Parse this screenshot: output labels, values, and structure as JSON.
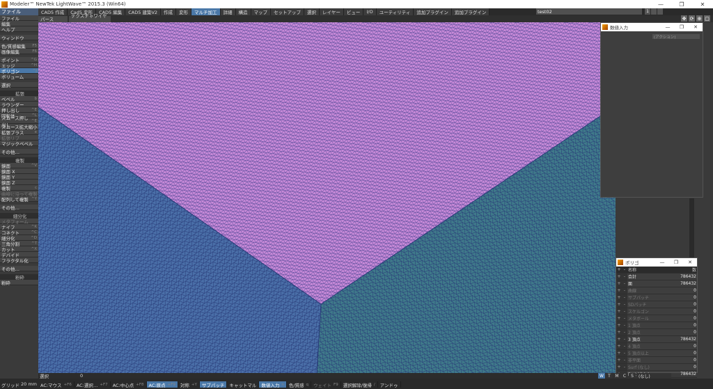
{
  "window": {
    "title": "Modeler™ NewTek LightWave™ 2015.3 (Win64)",
    "buttons": [
      "—",
      "❐",
      "✕"
    ]
  },
  "menubar": {
    "left": "ファイル",
    "tabs": [
      {
        "label": "CAD5 作成",
        "active": false
      },
      {
        "label": "Cad5 変形",
        "active": false
      },
      {
        "label": "CAD5 編集",
        "active": false
      },
      {
        "label": "CAD5 建築V2",
        "active": false
      },
      {
        "label": "作成",
        "active": false
      },
      {
        "label": "変形",
        "active": false
      },
      {
        "label": "マルチ加工",
        "active": true
      },
      {
        "label": "詳細",
        "active": false
      },
      {
        "label": "構造",
        "active": false
      },
      {
        "label": "マップ",
        "active": false
      },
      {
        "label": "セットアップ",
        "active": false
      },
      {
        "label": "選択",
        "active": false
      },
      {
        "label": "レイヤー",
        "active": false
      },
      {
        "label": "ビュー",
        "active": false
      },
      {
        "label": "I/O",
        "active": false
      },
      {
        "label": "ユーティリティ",
        "active": false
      },
      {
        "label": "追加プラグイン",
        "active": false
      },
      {
        "label": "追加プラグイン",
        "active": false
      }
    ],
    "object": "test02",
    "layers": [
      "1"
    ]
  },
  "toolbar": {
    "view_dropdown": "パース",
    "mode_dropdown": "テクスチャワイヤー"
  },
  "sidebar": [
    {
      "label": "ファイル",
      "key": "",
      "type": "item"
    },
    {
      "label": "編集",
      "key": "",
      "type": "item"
    },
    {
      "label": "ヘルプ",
      "key": "",
      "type": "item"
    },
    {
      "label": "",
      "key": "",
      "type": "gap"
    },
    {
      "label": "ウィンドウ",
      "key": "",
      "type": "item"
    },
    {
      "label": "",
      "key": "",
      "type": "gap"
    },
    {
      "label": "色/質感編集",
      "key": "F5",
      "type": "item"
    },
    {
      "label": "画像編集",
      "key": "F6",
      "type": "item"
    },
    {
      "label": "",
      "key": "",
      "type": "gap"
    },
    {
      "label": "ポイント",
      "key": "^G",
      "type": "item"
    },
    {
      "label": "エッジ",
      "key": "^H",
      "type": "item"
    },
    {
      "label": "ポリゴン",
      "key": "^J",
      "type": "sel"
    },
    {
      "label": "ボリューム",
      "key": "",
      "type": "item"
    },
    {
      "label": "",
      "key": "",
      "type": "gap"
    },
    {
      "label": "選択",
      "key": "",
      "type": "item"
    },
    {
      "label": "",
      "key": "",
      "type": "gap"
    },
    {
      "label": "拡張",
      "key": "",
      "type": "hdr"
    },
    {
      "label": "ベベル",
      "key": "b",
      "type": "item"
    },
    {
      "label": "ラウンダー",
      "key": "",
      "type": "item"
    },
    {
      "label": "押し出し",
      "key": "^E",
      "type": "item"
    },
    {
      "label": "回転体",
      "key": "^L",
      "type": "item"
    },
    {
      "label": "スムース押し出し",
      "key": "^E",
      "type": "item"
    },
    {
      "label": "スムース拡大縮小",
      "key": "",
      "type": "item"
    },
    {
      "label": "拡張プラス",
      "key": "e",
      "type": "item"
    },
    {
      "label": "拡張リブ",
      "key": "",
      "type": "dis"
    },
    {
      "label": "マジックベベル",
      "key": "",
      "type": "item"
    },
    {
      "label": "",
      "key": "",
      "type": "gap"
    },
    {
      "label": "その他…",
      "key": "",
      "type": "item"
    },
    {
      "label": "",
      "key": "",
      "type": "gap"
    },
    {
      "label": "複製",
      "key": "",
      "type": "hdr"
    },
    {
      "label": "鏡面",
      "key": "^V",
      "type": "item"
    },
    {
      "label": "鏡面 X",
      "key": "",
      "type": "item"
    },
    {
      "label": "鏡面 Y",
      "key": "",
      "type": "item"
    },
    {
      "label": "鏡面 Z",
      "key": "",
      "type": "item"
    },
    {
      "label": "複製",
      "key": "c",
      "type": "item"
    },
    {
      "label": "曲線に沿って複製",
      "key": "",
      "type": "dis"
    },
    {
      "label": "配列して複製",
      "key": "^Y",
      "type": "item"
    },
    {
      "label": "",
      "key": "",
      "type": "gap"
    },
    {
      "label": "その他…",
      "key": "",
      "type": "item"
    },
    {
      "label": "",
      "key": "",
      "type": "gap"
    },
    {
      "label": "細分化",
      "key": "",
      "type": "hdr"
    },
    {
      "label": "メタフォーム",
      "key": "",
      "type": "dis"
    },
    {
      "label": "ナイフ",
      "key": "^K",
      "type": "item"
    },
    {
      "label": "コネクト",
      "key": "^C",
      "type": "item"
    },
    {
      "label": "細分化",
      "key": "^D",
      "type": "item"
    },
    {
      "label": "三角分割",
      "key": "^T",
      "type": "item"
    },
    {
      "label": "カット",
      "key": "^X",
      "type": "item"
    },
    {
      "label": "デバイド",
      "key": "",
      "type": "item"
    },
    {
      "label": "フラクタル化",
      "key": "",
      "type": "item"
    },
    {
      "label": "",
      "key": "",
      "type": "gap"
    },
    {
      "label": "その他…",
      "key": "",
      "type": "item"
    },
    {
      "label": "",
      "key": "",
      "type": "gap"
    },
    {
      "label": "粉砕",
      "key": "",
      "type": "hdr"
    },
    {
      "label": "粉砕",
      "key": "",
      "type": "item"
    }
  ],
  "numeric_panel": {
    "title": "数値入力",
    "select": "(アクション)"
  },
  "poly_panel": {
    "title": "ポリゴ",
    "header": {
      "name": "名称",
      "count": "数"
    },
    "rows": [
      {
        "c1": "+",
        "c2": "-",
        "name": "合計",
        "value": "786432",
        "dim": false
      },
      {
        "c1": "+",
        "c2": "-",
        "name": "面",
        "value": "786432",
        "dim": false
      },
      {
        "c1": "+",
        "c2": "-",
        "name": "曲線",
        "value": "0",
        "dim": true
      },
      {
        "c1": "+",
        "c2": "-",
        "name": "サブパッチ",
        "value": "0",
        "dim": true
      },
      {
        "c1": "+",
        "c2": "-",
        "name": "SDパッチ",
        "value": "0",
        "dim": true
      },
      {
        "c1": "+",
        "c2": "-",
        "name": "スケルゴン",
        "value": "0",
        "dim": true
      },
      {
        "c1": "+",
        "c2": "-",
        "name": "メタボール",
        "value": "0",
        "dim": true
      },
      {
        "c1": "+",
        "c2": "-",
        "name": "1 頂点",
        "value": "0",
        "dim": true
      },
      {
        "c1": "+",
        "c2": "-",
        "name": "2 頂点",
        "value": "0",
        "dim": true
      },
      {
        "c1": "+",
        "c2": "-",
        "name": "3 頂点",
        "value": "786432",
        "dim": false
      },
      {
        "c1": "+",
        "c2": "-",
        "name": "4 頂点",
        "value": "0",
        "dim": true
      },
      {
        "c1": "+",
        "c2": "-",
        "name": "5 頂点以上",
        "value": "0",
        "dim": true
      },
      {
        "c1": "+",
        "c2": "-",
        "name": "非平面",
        "value": "0",
        "dim": true
      },
      {
        "c1": "+",
        "c2": "-",
        "name": "Surf (なし)",
        "value": "0",
        "dim": true
      },
      {
        "c1": "+",
        "c2": "-",
        "name": "Part (なし)",
        "value": "786432",
        "dim": false
      },
      {
        "c1": "+",
        "c2": "-",
        "name": "Sel (なし)",
        "value": "0",
        "dim": true
      }
    ]
  },
  "status": {
    "label": "選択",
    "value": "0"
  },
  "grid": {
    "label": "グリッド",
    "value": "20 mm"
  },
  "bottom_buttons": [
    {
      "label": "AC:マウス",
      "key": "+F6",
      "style": "normal"
    },
    {
      "label": "AC:選択…",
      "key": "+F7",
      "style": "normal"
    },
    {
      "label": "AC:中心点",
      "key": "+F8",
      "style": "normal"
    },
    {
      "label": "AC:原点",
      "key": "+F9",
      "style": "hi"
    },
    {
      "label": "対称",
      "key": "+Y",
      "style": "normal"
    },
    {
      "label": "サブパッチ",
      "key": "",
      "style": "hi"
    },
    {
      "label": "キャットマル",
      "key": "",
      "style": "normal"
    },
    {
      "label": "数値入力",
      "key": "n",
      "style": "hi"
    },
    {
      "label": "色/質感",
      "key": "q",
      "style": "normal"
    },
    {
      "label": "ウェイト",
      "key": "F9",
      "style": "dis"
    },
    {
      "label": "選択解除/復帰",
      "key": "/",
      "style": "normal"
    },
    {
      "label": "アンドゥ",
      "key": "",
      "style": "normal"
    }
  ],
  "view_modes": [
    {
      "label": "W",
      "on": true
    },
    {
      "label": "T",
      "on": false
    },
    {
      "label": "M",
      "on": false
    },
    {
      "label": "C",
      "on": false
    },
    {
      "label": "S",
      "on": false
    }
  ],
  "view_mode_none": "(なし)",
  "colors": {
    "accent": "#4a78a8",
    "face_top": "#c88ad8",
    "face_left": "#4a6fa8",
    "face_right": "#3f7a8a",
    "wire": "#283a78"
  }
}
